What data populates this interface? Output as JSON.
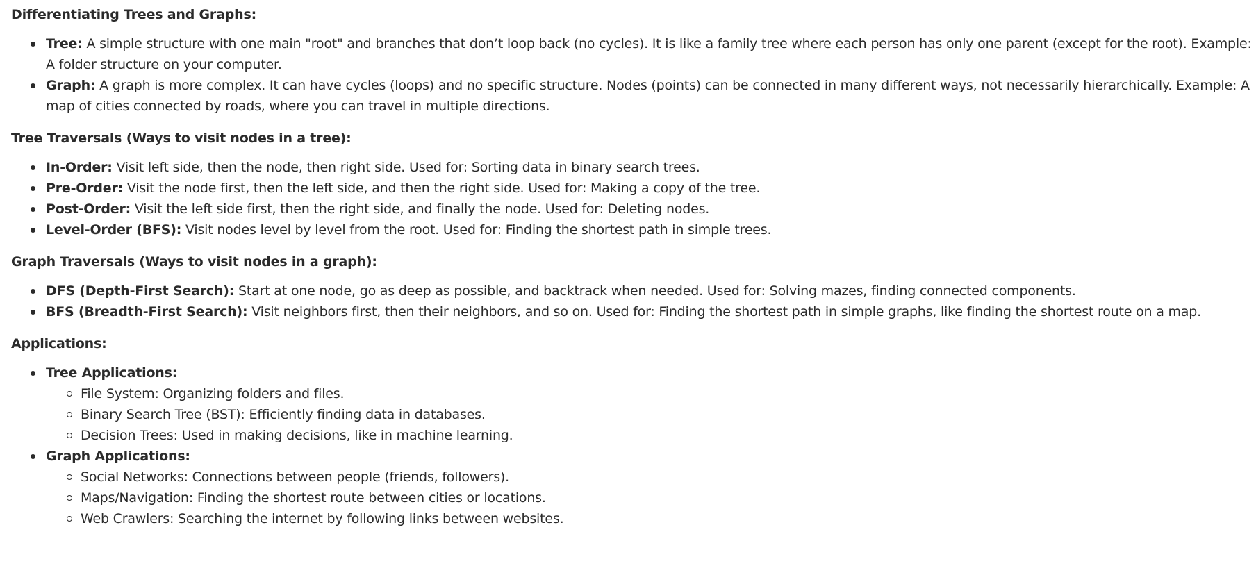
{
  "sections": [
    {
      "heading": "Differentiating Trees and Graphs:",
      "items": [
        {
          "label": "Tree:",
          "text": " A simple structure with one main \"root\" and branches that don’t loop back (no cycles). It is like a family tree where each person has only one parent (except for the root). Example: A folder structure on your computer."
        },
        {
          "label": "Graph:",
          "text": " A graph is more complex. It can have cycles (loops) and no specific structure. Nodes (points) can be connected in many different ways, not necessarily hierarchically. Example: A map of cities connected by roads, where you can travel in multiple directions."
        }
      ]
    },
    {
      "heading": "Tree Traversals (Ways to visit nodes in a tree):",
      "items": [
        {
          "label": "In-Order:",
          "text": " Visit left side, then the node, then right side. Used for: Sorting data in binary search trees."
        },
        {
          "label": "Pre-Order:",
          "text": " Visit the node first, then the left side, and then the right side. Used for: Making a copy of the tree."
        },
        {
          "label": "Post-Order:",
          "text": " Visit the left side first, then the right side, and finally the node. Used for: Deleting nodes."
        },
        {
          "label": "Level-Order (BFS):",
          "text": " Visit nodes level by level from the root. Used for: Finding the shortest path in simple trees."
        }
      ]
    },
    {
      "heading": "Graph Traversals (Ways to visit nodes in a graph):",
      "items": [
        {
          "label": "DFS (Depth-First Search):",
          "text": " Start at one node, go as deep as possible, and backtrack when needed. Used for: Solving mazes, finding connected components."
        },
        {
          "label": "BFS (Breadth-First Search):",
          "text": " Visit neighbors first, then their neighbors, and so on. Used for: Finding the shortest path in simple graphs, like finding the shortest route on a map."
        }
      ]
    },
    {
      "heading": "Applications:",
      "groups": [
        {
          "label": "Tree Applications:",
          "subitems": [
            "File System: Organizing folders and files.",
            "Binary Search Tree (BST): Efficiently finding data in databases.",
            "Decision Trees: Used in making decisions, like in machine learning."
          ]
        },
        {
          "label": "Graph Applications:",
          "subitems": [
            "Social Networks: Connections between people (friends, followers).",
            "Maps/Navigation: Finding the shortest route between cities or locations.",
            "Web Crawlers: Searching the internet by following links between websites."
          ]
        }
      ]
    }
  ]
}
